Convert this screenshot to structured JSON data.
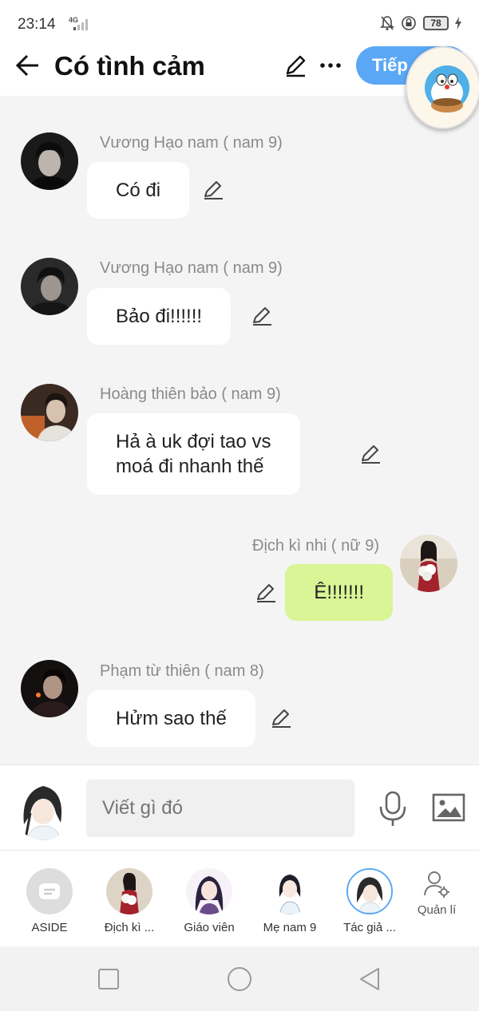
{
  "status_bar": {
    "time": "23:14",
    "network": "4G",
    "battery": "78"
  },
  "header": {
    "title": "Có tình cảm",
    "next_label": "Tiếp"
  },
  "messages": [
    {
      "sender": "Vương Hạo nam ( nam 9)",
      "text": "Có đi",
      "side": "left"
    },
    {
      "sender": "Vương Hạo nam ( nam 9)",
      "text": "Bảo đi!!!!!!",
      "side": "left"
    },
    {
      "sender": "Hoàng thiên bảo ( nam 9)",
      "text_lines": [
        "Hả à uk đợi tao vs",
        "moá đi nhanh thế"
      ],
      "side": "left"
    },
    {
      "sender": "Địch kì nhi ( nữ 9)",
      "text": "Ê!!!!!!!",
      "side": "right"
    },
    {
      "sender": "Phạm từ thiên ( nam 8)",
      "text": "Hửm sao thế",
      "side": "left"
    }
  ],
  "composer": {
    "placeholder": "Viết gì đó"
  },
  "characters": [
    {
      "label": "ASIDE"
    },
    {
      "label": "Địch kì ..."
    },
    {
      "label": "Giáo viên"
    },
    {
      "label": "Mẹ nam 9"
    },
    {
      "label": "Tác giả ..."
    },
    {
      "label": "Quản lí"
    }
  ],
  "colors": {
    "accent_blue": "#5aa8f5",
    "my_bubble": "#d9f596",
    "background": "#f4f4f4"
  }
}
